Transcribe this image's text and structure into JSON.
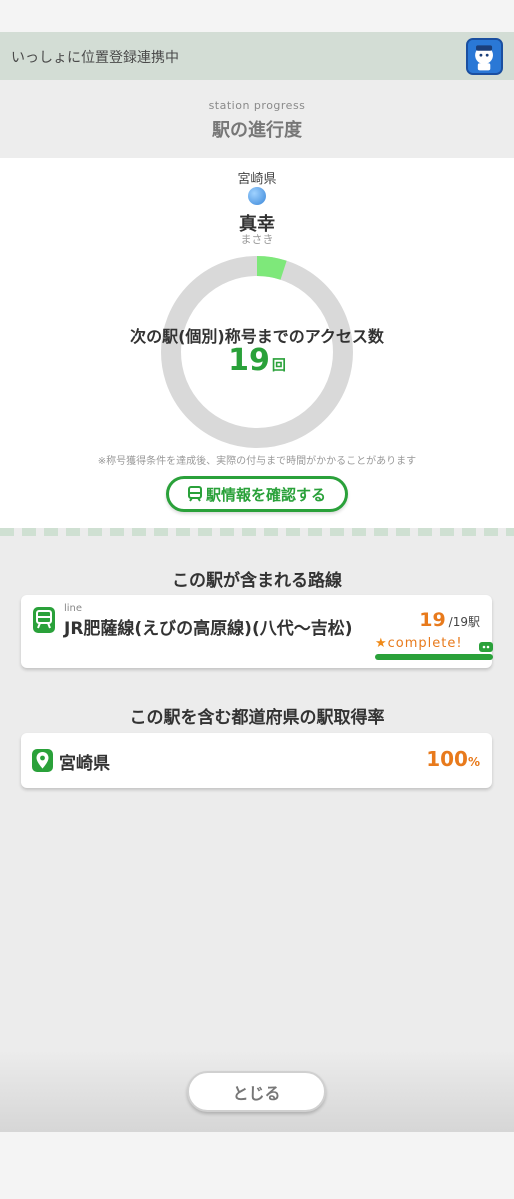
{
  "banner": {
    "text": "いっしょに位置登録連携中"
  },
  "header": {
    "subtitle": "station progress",
    "title": "駅の進行度"
  },
  "station": {
    "prefecture": "宮崎県",
    "name": "真幸",
    "kana": "まさき",
    "ring_label": "次の駅(個別)称号までのアクセス数",
    "access_count": "19",
    "access_unit": "回",
    "progress_fraction": 0.05,
    "note": "※称号獲得条件を達成後、実際の付与まで時間がかかることがあります",
    "button_label": "駅情報を確認する"
  },
  "lines_section": {
    "title": "この駅が含まれる路線",
    "items": [
      {
        "small_label": "line",
        "name": "JR肥薩線(えびの高原線)(八代〜吉松)",
        "count": "19",
        "total": "/19駅",
        "status": "complete!"
      }
    ]
  },
  "pref_section": {
    "title": "この駅を含む都道府県の駅取得率",
    "items": [
      {
        "name": "宮崎県",
        "rate": "100",
        "unit": "%"
      }
    ]
  },
  "close_button": {
    "label": "とじる"
  },
  "colors": {
    "accent_green": "#2aa13a",
    "accent_orange": "#e87a1c",
    "ring_gray": "#d9d9d9",
    "progress_green": "#7ee87a"
  },
  "icons": {
    "app": "mascot-app-icon",
    "train": "train-icon",
    "location": "location-pin-icon",
    "star": "star-icon"
  }
}
